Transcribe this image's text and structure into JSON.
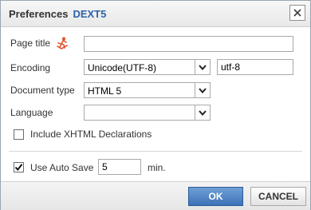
{
  "dialog": {
    "title": "Preferences",
    "brand": "DEXT5"
  },
  "form": {
    "page_title_label": "Page title",
    "page_title_value": "",
    "encoding_label": "Encoding",
    "encoding_selected": "Unicode(UTF-8)",
    "encoding_code": "utf-8",
    "doctype_label": "Document type",
    "doctype_selected": "HTML 5",
    "language_label": "Language",
    "language_selected": "",
    "xhtml_label": "Include XHTML Declarations",
    "xhtml_checked": false,
    "autosave_label": "Use Auto Save",
    "autosave_checked": true,
    "autosave_minutes": "5",
    "autosave_unit": "min."
  },
  "footer": {
    "ok_label": "OK",
    "cancel_label": "CANCEL"
  },
  "colors": {
    "brand": "#2b63a6",
    "ok_button": "#3e72b8",
    "icon_accent": "#e0532b"
  },
  "icons": {
    "close": "close-icon",
    "page_title_helper": "figure-icon",
    "dropdown": "chevron-down-icon",
    "checkmark": "checkmark-icon"
  }
}
